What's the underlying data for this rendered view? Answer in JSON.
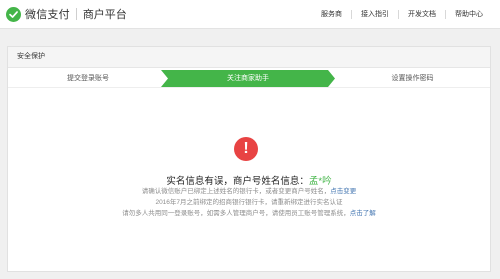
{
  "header": {
    "logo_text": "微信支付",
    "platform": "商户平台",
    "nav": [
      "服务商",
      "接入指引",
      "开发文档",
      "帮助中心"
    ]
  },
  "card": {
    "title": "安全保护",
    "steps": [
      "提交登录账号",
      "关注商家助手",
      "设置操作密码"
    ],
    "active_step": 1
  },
  "message": {
    "title_prefix": "实名信息有误，商户号姓名信息：",
    "merchant_name": "孟*吟",
    "line1_text": "请确认微信账户已绑定上述姓名的银行卡，或者变更商户号姓名，",
    "line1_link": "点击变更",
    "line2_text": "2016年7月之前绑定的招商银行银行卡，请重新绑定进行实名认证",
    "line3_text": "请勿多人共用同一登录账号，如需多人管理商户号，请使用员工账号管理系统，",
    "line3_link": "点击了解"
  },
  "colors": {
    "brand_green": "#44b549",
    "alert_red": "#e84343",
    "link_blue": "#4174b0"
  }
}
